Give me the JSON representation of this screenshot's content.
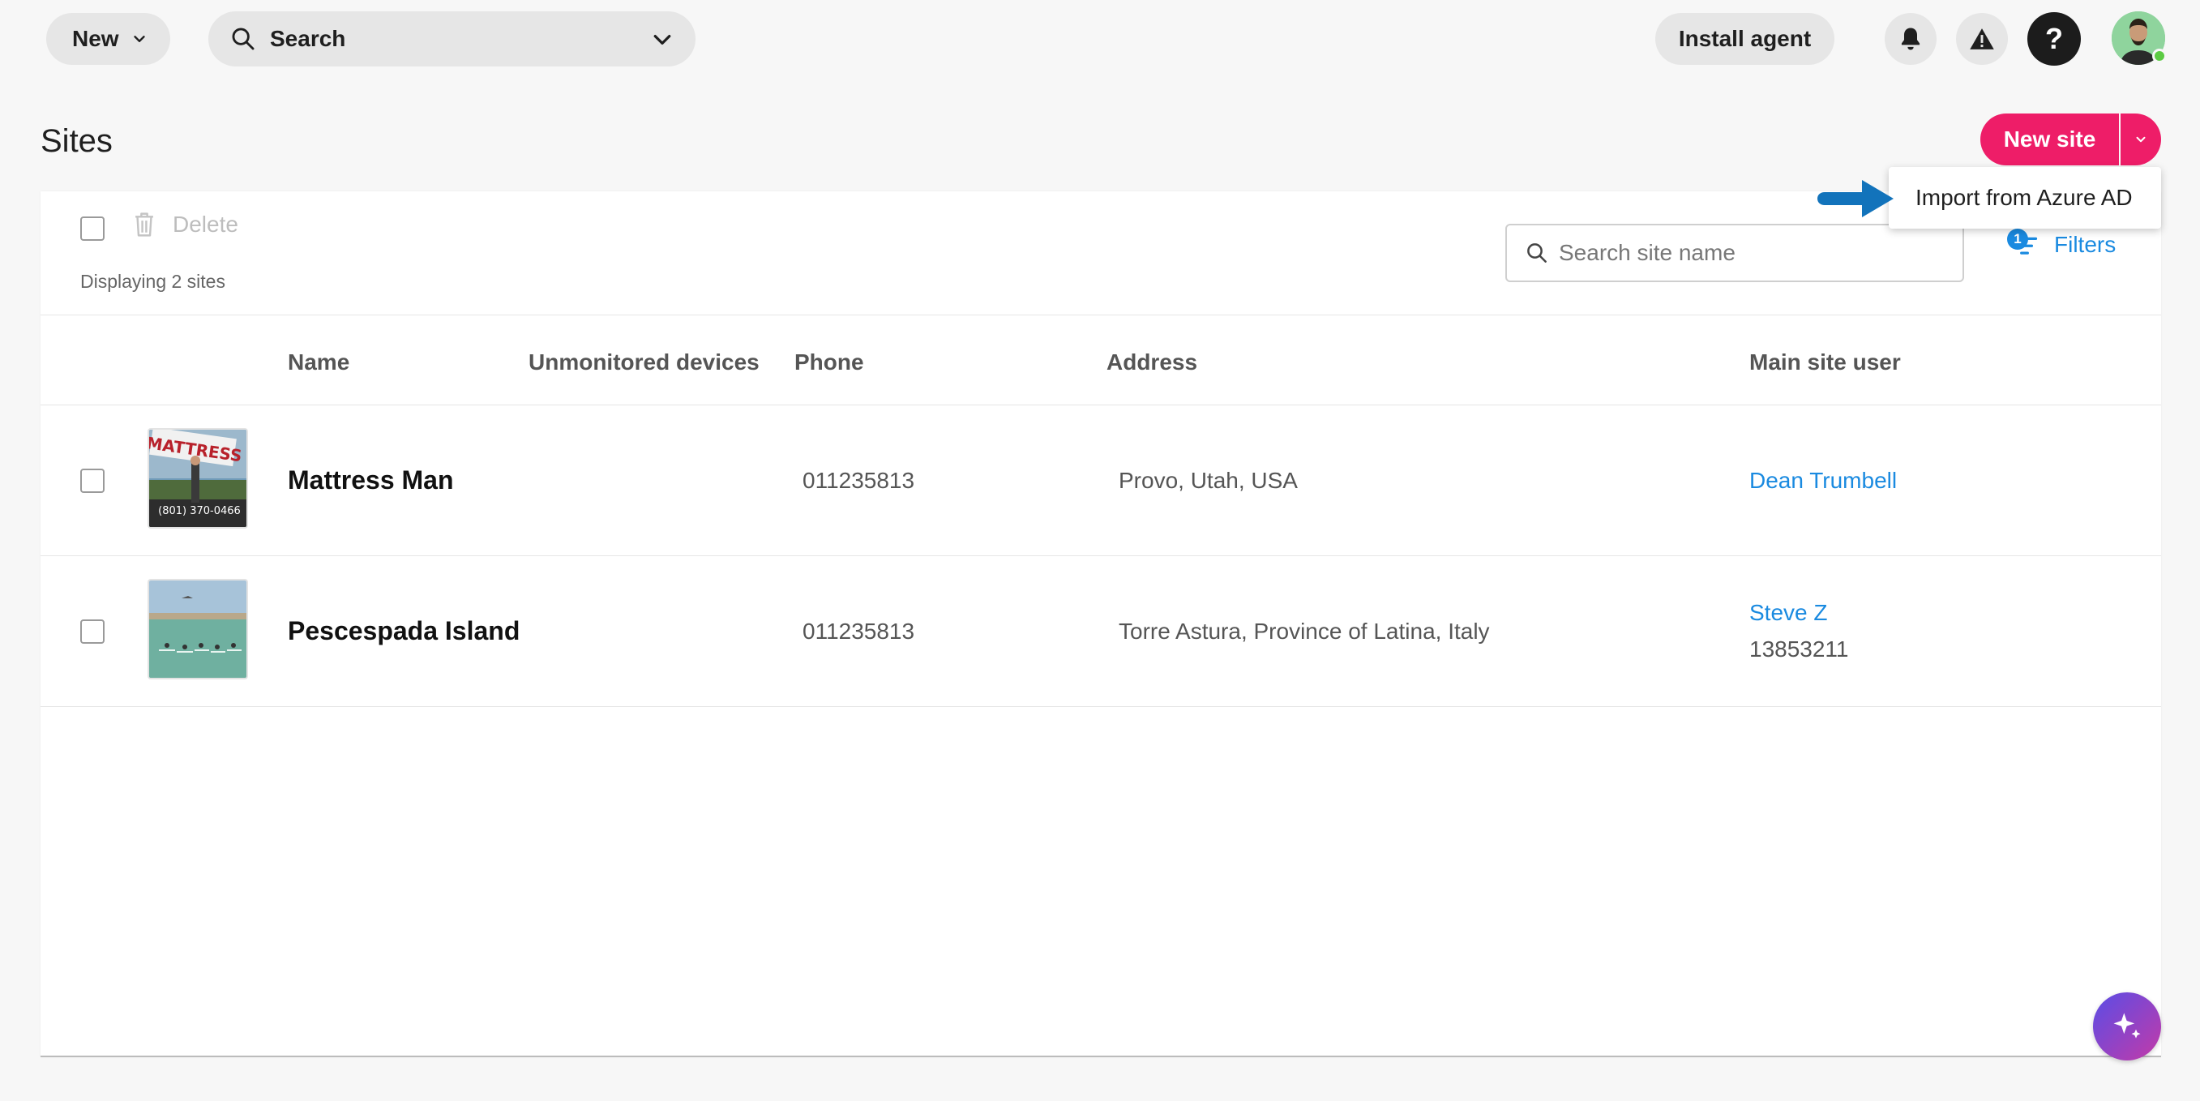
{
  "topbar": {
    "new_label": "New",
    "search_label": "Search",
    "install_label": "Install agent",
    "help_label": "?"
  },
  "page": {
    "title": "Sites",
    "new_site_label": "New site",
    "menu": {
      "import_azure": "Import from Azure AD"
    }
  },
  "toolbar": {
    "delete_label": "Delete",
    "display_count": "Displaying 2 sites",
    "search_placeholder": "Search site name",
    "filters_label": "Filters",
    "filters_count": "1"
  },
  "table": {
    "columns": {
      "name": "Name",
      "unmonitored": "Unmonitored devices",
      "phone": "Phone",
      "address": "Address",
      "main_user": "Main site user"
    },
    "rows": [
      {
        "name": "Mattress Man",
        "phone": "011235813",
        "address": "Provo, Utah, USA",
        "main_user": "Dean Trumbell",
        "thumb_sign": "MATTRESS",
        "thumb_phone": "(801) 370-0466"
      },
      {
        "name": "Pescespada Island",
        "phone": "011235813",
        "address": "Torre Astura, Province of Latina, Italy",
        "main_user": "Steve Z",
        "main_user_sub": "13853211"
      }
    ]
  },
  "colors": {
    "brand_pink": "#ee1d68",
    "link_blue": "#1a8ae0",
    "arrow_blue": "#1273bb"
  },
  "icons": [
    "chevron-down-icon",
    "search-icon",
    "bell-icon",
    "warning-icon",
    "trash-icon",
    "filter-icon",
    "sparkle-icon"
  ]
}
